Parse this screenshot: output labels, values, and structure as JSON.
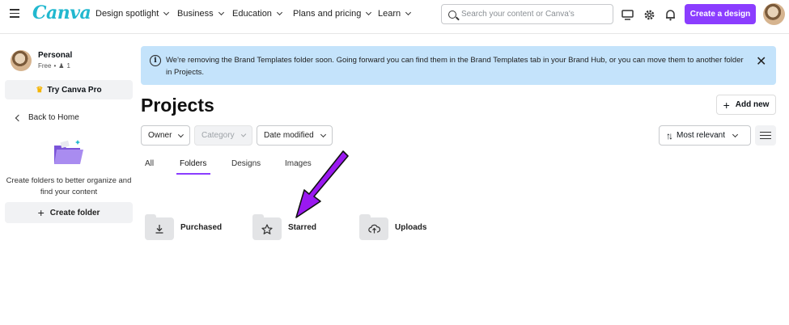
{
  "header": {
    "logo": "Canva",
    "nav": [
      {
        "label": "Design spotlight"
      },
      {
        "label": "Business"
      },
      {
        "label": "Education"
      },
      {
        "label": "Plans and pricing"
      },
      {
        "label": "Learn"
      }
    ],
    "search_placeholder": "Search your content or Canva's",
    "create_button": "Create a design",
    "icons": [
      "hamburger-icon",
      "monitor-icon",
      "gear-icon",
      "bell-icon"
    ]
  },
  "sidebar": {
    "account_name": "Personal",
    "plan": "Free",
    "members": "1",
    "try_pro": "Try Canva Pro",
    "back_home": "Back to Home",
    "empty_text": "Create folders to better organize and find your content",
    "create_folder": "Create folder"
  },
  "banner": {
    "text": "We're removing the Brand Templates folder soon. Going forward you can find them in the Brand Templates tab in your Brand Hub, or you can move them to another folder in Projects."
  },
  "main": {
    "title": "Projects",
    "add_new": "Add new",
    "filters": [
      {
        "label": "Owner",
        "disabled": false
      },
      {
        "label": "Category",
        "disabled": true
      },
      {
        "label": "Date modified",
        "disabled": false
      }
    ],
    "sort": "Most relevant",
    "tabs": [
      {
        "label": "All",
        "active": false
      },
      {
        "label": "Folders",
        "active": true
      },
      {
        "label": "Designs",
        "active": false
      },
      {
        "label": "Images",
        "active": false
      }
    ],
    "folders": [
      {
        "name": "Purchased",
        "icon": "download-icon"
      },
      {
        "name": "Starred",
        "icon": "star-icon"
      },
      {
        "name": "Uploads",
        "icon": "cloud-upload-icon"
      }
    ]
  },
  "colors": {
    "accent": "#8b3dff",
    "banner_bg": "#c4e3fb",
    "logo": "#22b8cf",
    "arrow": "#9a19f0"
  }
}
